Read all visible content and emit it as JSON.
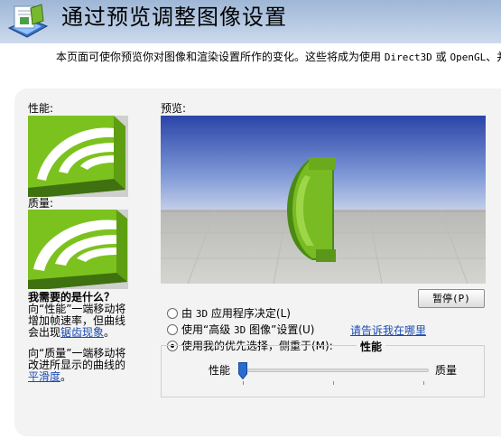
{
  "header": {
    "title": "通过预览调整图像设置",
    "description_prefix": "本页面可使你预览你对图像和渲染设置所作的变化。这些将成为使用 ",
    "description_mono1": "Direct3D",
    "description_mid": " 或 ",
    "description_mono2": "OpenGL",
    "description_suffix": "、并"
  },
  "left": {
    "performance_label": "性能:",
    "quality_label": "质量:",
    "help_title": "我需要的是什么？",
    "help_perf_prefix": "向“性能”一端移动将增加帧速率，但曲线会出现",
    "help_perf_link": "锯齿现象",
    "help_perf_suffix": "。",
    "help_quality_prefix": "向“质量”一端移动将改进所显示的曲线的",
    "help_quality_link": "平滑度",
    "help_quality_suffix": "。"
  },
  "preview": {
    "label": "预览:",
    "pause_label": "暂停(P)"
  },
  "options": {
    "app_decide": {
      "prefix": "由 ",
      "mono": "3D",
      "suffix": " 应用程序决定(L)"
    },
    "advanced": {
      "prefix": "使用“高级 ",
      "mono": "3D",
      "suffix": " 图像”设置(U)"
    },
    "preference": "使用我的优先选择，侧重于(M):",
    "selected": "preference",
    "tell_me_link": "请告诉我在哪里"
  },
  "slider": {
    "group_title": "性能",
    "left_label": "性能",
    "right_label": "质量",
    "value": 0.0,
    "ticks": 4
  }
}
